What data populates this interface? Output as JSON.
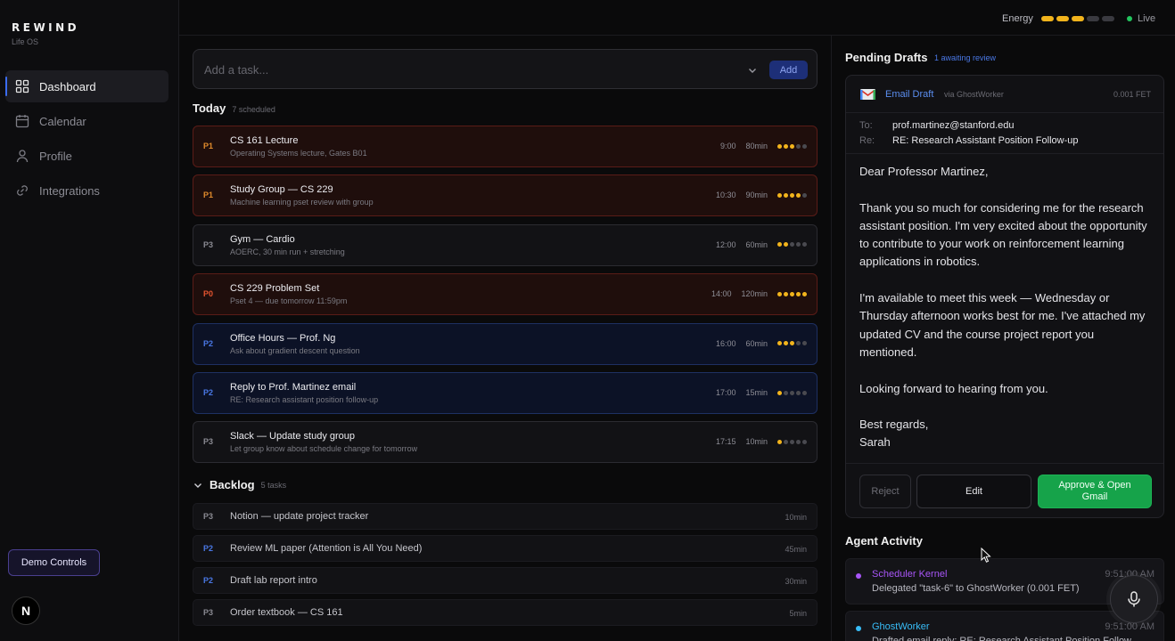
{
  "brand": {
    "name": "REWIND",
    "subtitle": "Life OS"
  },
  "nav": [
    {
      "label": "Dashboard",
      "icon": "grid-icon",
      "active": true
    },
    {
      "label": "Calendar",
      "icon": "calendar-icon",
      "active": false
    },
    {
      "label": "Profile",
      "icon": "user-icon",
      "active": false
    },
    {
      "label": "Integrations",
      "icon": "link-icon",
      "active": false
    }
  ],
  "demo_controls": "Demo Controls",
  "logo_letter": "N",
  "topbar": {
    "energy_label": "Energy",
    "energy_level": 3,
    "energy_max": 5,
    "status": "Live"
  },
  "task_input": {
    "placeholder": "Add a task...",
    "add_label": "Add"
  },
  "today": {
    "title": "Today",
    "count": "7 scheduled"
  },
  "tasks": [
    {
      "priority": "P1",
      "title": "CS 161 Lecture",
      "subtitle": "Operating Systems lecture, Gates B01",
      "time": "9:00",
      "duration": "80min",
      "energy": 3
    },
    {
      "priority": "P1",
      "title": "Study Group — CS 229",
      "subtitle": "Machine learning pset review with group",
      "time": "10:30",
      "duration": "90min",
      "energy": 4
    },
    {
      "priority": "P3",
      "title": "Gym — Cardio",
      "subtitle": "AOERC, 30 min run + stretching",
      "time": "12:00",
      "duration": "60min",
      "energy": 2
    },
    {
      "priority": "P0",
      "title": "CS 229 Problem Set",
      "subtitle": "Pset 4 — due tomorrow 11:59pm",
      "time": "14:00",
      "duration": "120min",
      "energy": 5
    },
    {
      "priority": "P2",
      "title": "Office Hours — Prof. Ng",
      "subtitle": "Ask about gradient descent question",
      "time": "16:00",
      "duration": "60min",
      "energy": 3
    },
    {
      "priority": "P2",
      "title": "Reply to Prof. Martinez email",
      "subtitle": "RE: Research assistant position follow-up",
      "time": "17:00",
      "duration": "15min",
      "energy": 1
    },
    {
      "priority": "P3",
      "title": "Slack — Update study group",
      "subtitle": "Let group know about schedule change for tomorrow",
      "time": "17:15",
      "duration": "10min",
      "energy": 1
    }
  ],
  "backlog": {
    "title": "Backlog",
    "count": "5 tasks"
  },
  "backlog_items": [
    {
      "priority": "P3",
      "title": "Notion — update project tracker",
      "duration": "10min"
    },
    {
      "priority": "P2",
      "title": "Review ML paper (Attention is All You Need)",
      "duration": "45min"
    },
    {
      "priority": "P2",
      "title": "Draft lab report intro",
      "duration": "30min"
    },
    {
      "priority": "P3",
      "title": "Order textbook — CS 161",
      "duration": "5min"
    }
  ],
  "pending": {
    "title": "Pending Drafts",
    "badge": "1 awaiting review"
  },
  "draft": {
    "type": "Email Draft",
    "via": "via GhostWorker",
    "cost": "0.001 FET",
    "to_label": "To:",
    "to": "prof.martinez@stanford.edu",
    "re_label": "Re:",
    "subject": "RE: Research Assistant Position Follow-up",
    "body": "Dear Professor Martinez,\n\nThank you so much for considering me for the research assistant position. I'm very excited about the opportunity to contribute to your work on reinforcement learning applications in robotics.\n\nI'm available to meet this week — Wednesday or Thursday afternoon works best for me. I've attached my updated CV and the course project report you mentioned.\n\nLooking forward to hearing from you.\n\nBest regards,\nSarah",
    "reject": "Reject",
    "edit": "Edit",
    "approve": "Approve & Open Gmail"
  },
  "agent_activity": {
    "title": "Agent Activity"
  },
  "activity": [
    {
      "agent": "Scheduler Kernel",
      "time": "9:51:00 AM",
      "text": "Delegated \"task-6\" to GhostWorker (0.001 FET)",
      "color": "#a855f7"
    },
    {
      "agent": "GhostWorker",
      "time": "9:51:00 AM",
      "text": "Drafted email reply: RE: Research Assistant Position Follow",
      "color": "#38bdf8"
    }
  ]
}
